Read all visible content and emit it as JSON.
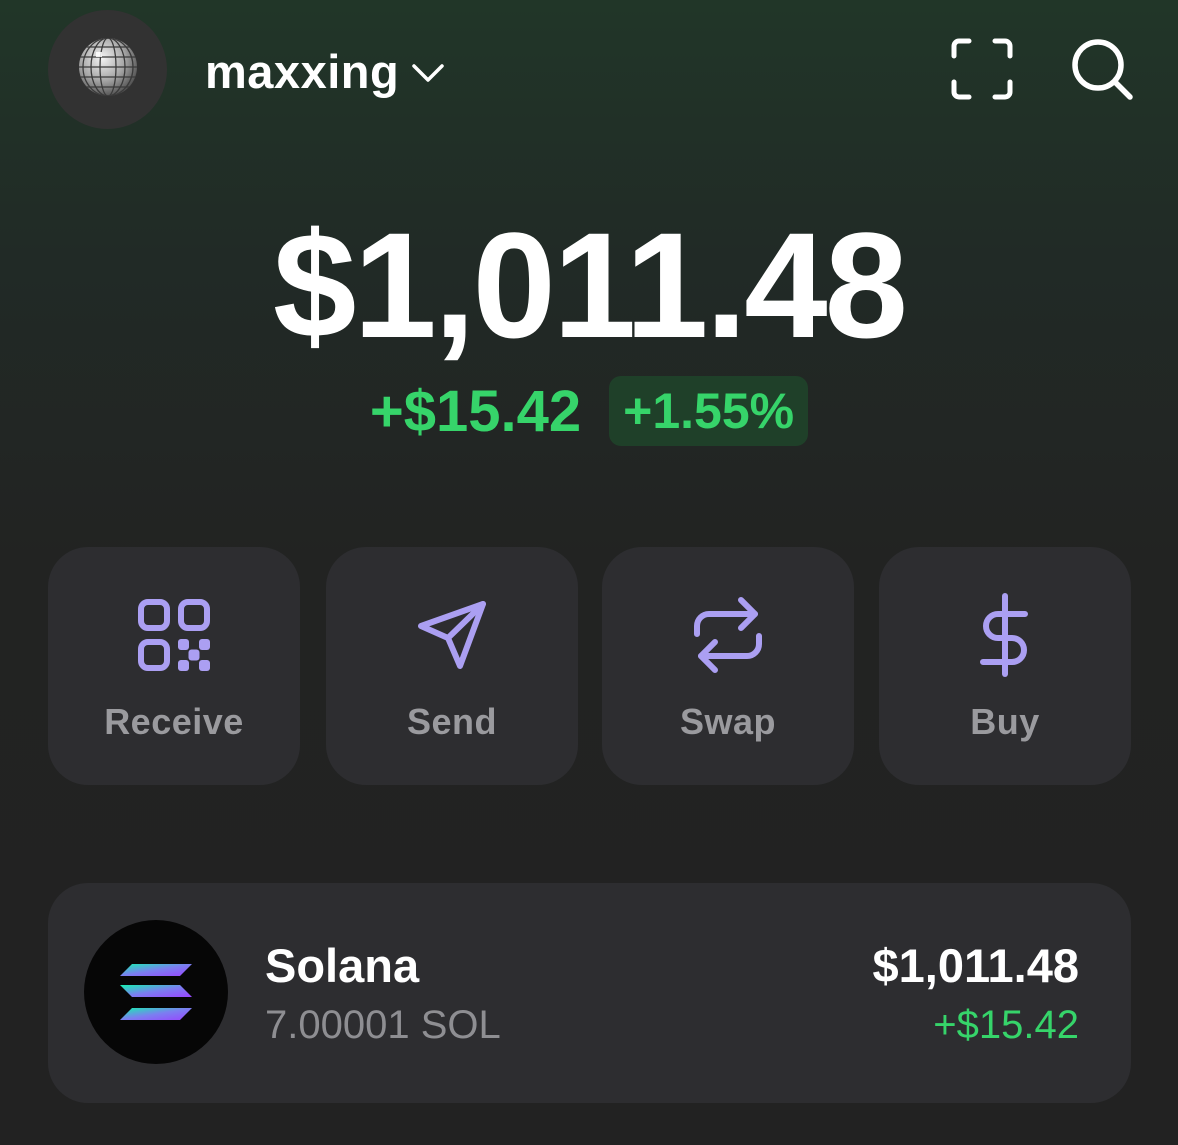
{
  "header": {
    "avatar_icon": "disco-ball-icon",
    "wallet_name": "maxxing",
    "switch_icon": "chevron-down-icon",
    "scan_icon": "scan-icon",
    "search_icon": "search-icon"
  },
  "portfolio": {
    "balance": "$1,011.48",
    "change_amount": "+$15.42",
    "change_percent": "+1.55%"
  },
  "actions": [
    {
      "label": "Receive",
      "icon": "qr-code-icon"
    },
    {
      "label": "Send",
      "icon": "send-icon"
    },
    {
      "label": "Swap",
      "icon": "swap-icon"
    },
    {
      "label": "Buy",
      "icon": "dollar-icon"
    }
  ],
  "tokens": [
    {
      "name": "Solana",
      "amount": "7.00001 SOL",
      "value": "$1,011.48",
      "change": "+$15.42",
      "icon": "solana-logo-icon"
    }
  ],
  "colors": {
    "accent": "#ab9ff2",
    "positive": "#36d46a",
    "card": "#2d2d30",
    "muted_text": "#9a9a9e"
  }
}
